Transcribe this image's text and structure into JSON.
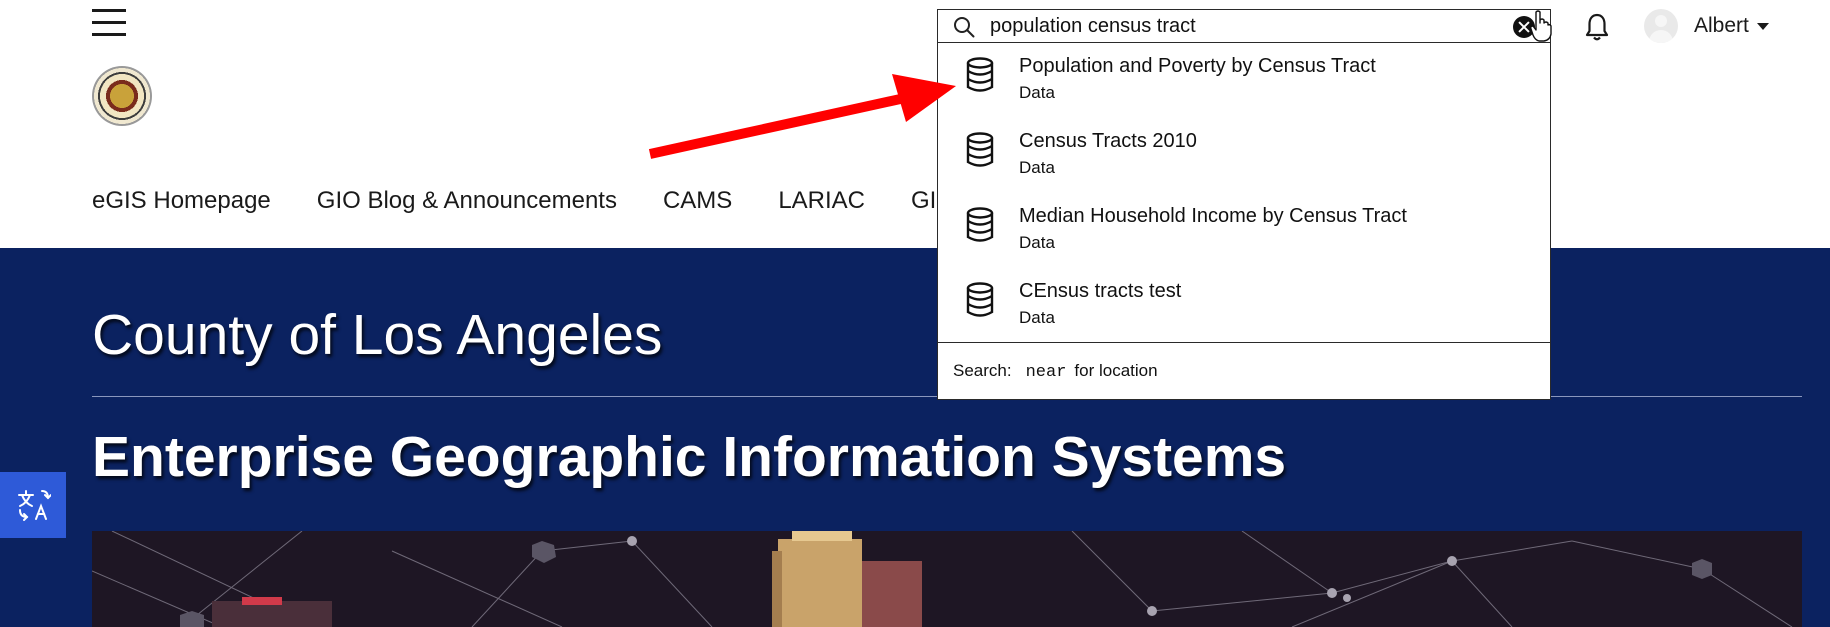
{
  "header": {
    "nav_items": [
      "eGIS Homepage",
      "GIO Blog & Announcements",
      "CAMS",
      "LARIAC",
      "GIS"
    ],
    "user_name": "Albert"
  },
  "search": {
    "value": "population census tract",
    "results": [
      {
        "title": "Population and Poverty by Census Tract",
        "type": "Data"
      },
      {
        "title": "Census Tracts 2010",
        "type": "Data"
      },
      {
        "title": "Median Household Income by Census Tract",
        "type": "Data"
      },
      {
        "title": "CEnsus tracts test",
        "type": "Data"
      }
    ],
    "hint_prefix": "Search:",
    "hint_keyword": "near",
    "hint_suffix": "for location"
  },
  "hero": {
    "title": "County of Los Angeles",
    "subtitle": "Enterprise Geographic Information Systems"
  },
  "colors": {
    "hero_background": "#0b2260",
    "translate_button": "#2e5ad8",
    "annotation_arrow": "#ff0000"
  },
  "icons": {
    "menu": "hamburger-menu-icon",
    "search": "search-icon",
    "clear": "clear-icon",
    "notifications": "bell-icon",
    "dataset": "database-icon",
    "translate": "translate-icon"
  }
}
